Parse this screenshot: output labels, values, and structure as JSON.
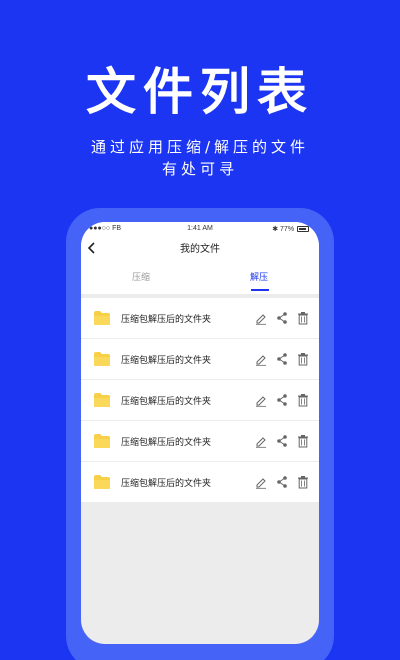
{
  "hero": {
    "title": "文件列表",
    "subtitle_line1": "通过应用压缩/解压的文件",
    "subtitle_line2": "有处可寻"
  },
  "status_bar": {
    "carrier": "●●●○○ FB",
    "time": "1:41 AM",
    "battery": "77%"
  },
  "nav": {
    "back_icon": "chevron-left-icon",
    "title": "我的文件"
  },
  "tabs": [
    {
      "label": "压缩",
      "active": false
    },
    {
      "label": "解压",
      "active": true
    }
  ],
  "files": [
    {
      "name": "压缩包解压后的文件夹"
    },
    {
      "name": "压缩包解压后的文件夹"
    },
    {
      "name": "压缩包解压后的文件夹"
    },
    {
      "name": "压缩包解压后的文件夹"
    },
    {
      "name": "压缩包解压后的文件夹"
    }
  ],
  "colors": {
    "background": "#1B35F2",
    "frame": "#4563F7",
    "accent": "#1B35F2",
    "folder": "#F7D047"
  }
}
